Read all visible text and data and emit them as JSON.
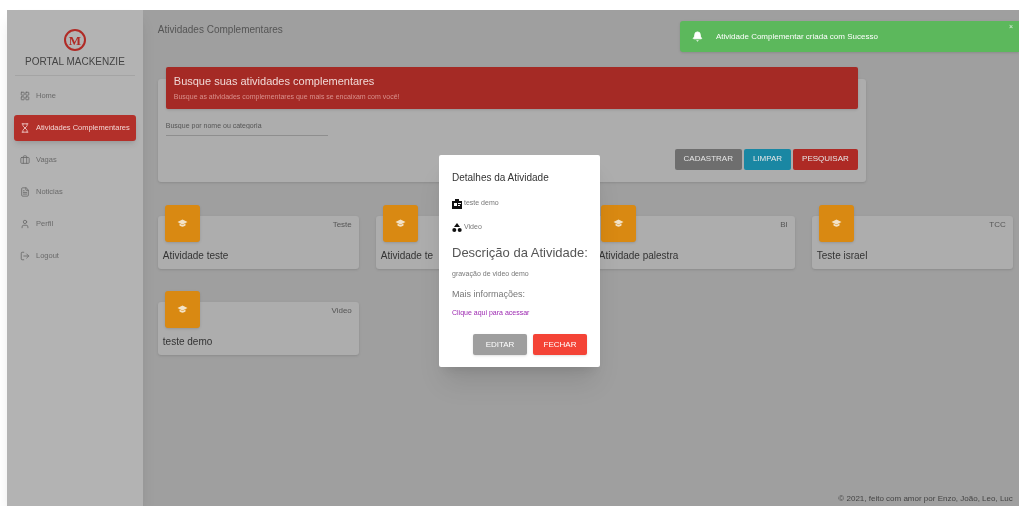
{
  "sidebar": {
    "logo_letter": "M",
    "title": "PORTAL MACKENZIE",
    "items": [
      {
        "label": "Home",
        "selected": false
      },
      {
        "label": "Atividades Complementares",
        "selected": true
      },
      {
        "label": "Vagas",
        "selected": false
      },
      {
        "label": "Noticias",
        "selected": false
      },
      {
        "label": "Perfil",
        "selected": false
      },
      {
        "label": "Logout",
        "selected": false
      }
    ]
  },
  "page_title": "Atividades Complementares",
  "search": {
    "title": "Busque suas atividades complementares",
    "subtitle": "Busque as atividades complementares que mais se encaixam com você!",
    "placeholder": "Busque por nome ou categoria",
    "buttons": [
      {
        "label": "CADASTRAR",
        "kind": "neutral"
      },
      {
        "label": "LIMPAR",
        "kind": "info"
      },
      {
        "label": "PESQUISAR",
        "kind": "primary"
      }
    ]
  },
  "cards": [
    {
      "title": "Atividade teste",
      "category": "Teste"
    },
    {
      "title": "Atividade te"
    },
    {
      "title": "Atividade palestra",
      "category": "BI"
    },
    {
      "title": "Teste israel",
      "category": "TCC"
    },
    {
      "title": "teste demo",
      "category": "Video"
    }
  ],
  "modal": {
    "title": "Detalhes da Atividade",
    "name": "teste demo",
    "category": "Video",
    "description_heading": "Descrição da Atividade:",
    "description": "gravação de video demo",
    "more_heading": "Mais informações:",
    "link": "Clique aqui para acessar",
    "buttons": [
      {
        "label": "EDITAR",
        "kind": "neutral"
      },
      {
        "label": "FECHAR",
        "kind": "danger"
      }
    ]
  },
  "toast": {
    "message": "Atividade Complementar criada com Sucesso",
    "close": "×"
  },
  "footer": "© 2021, feito com amor por Enzo, João, Leo, Luc"
}
